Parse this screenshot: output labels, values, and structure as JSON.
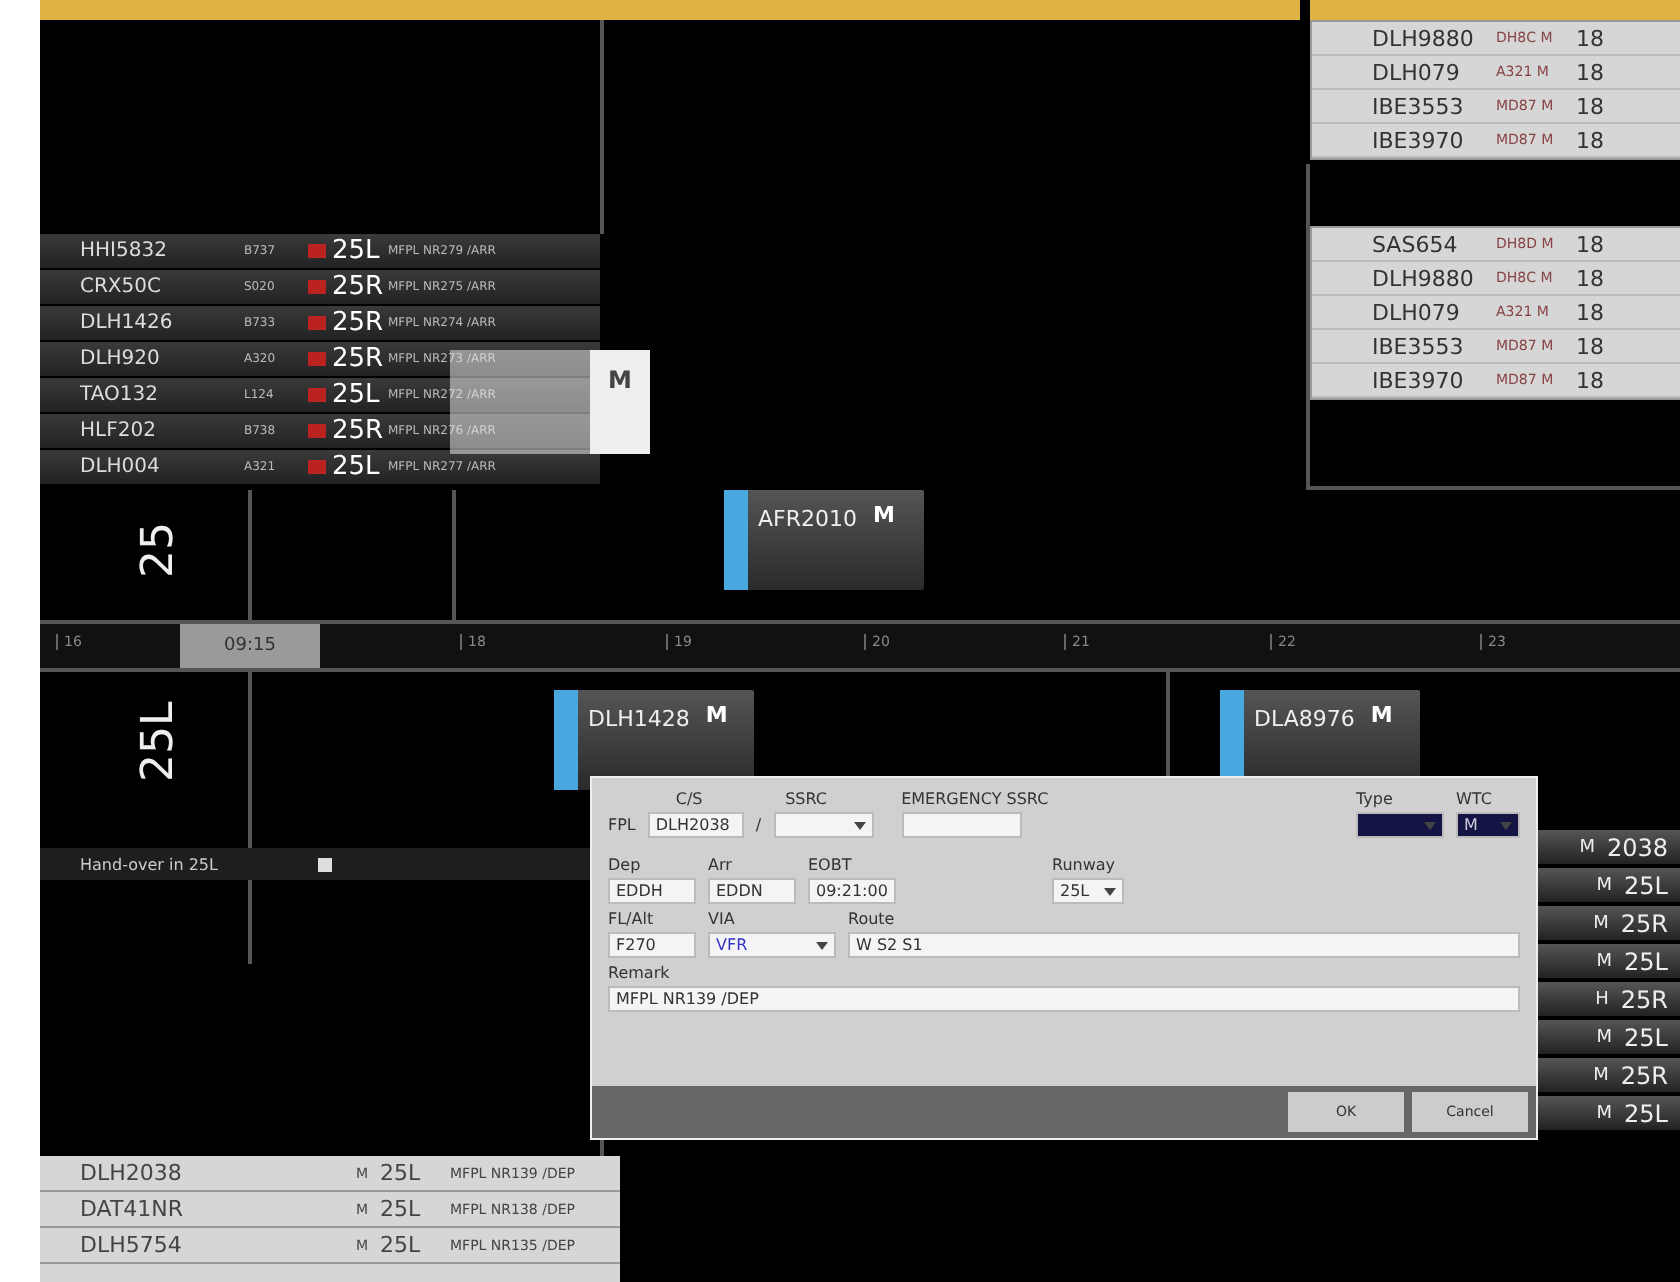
{
  "top_lists": [
    {
      "rows": [
        {
          "callsign": "DLH9880",
          "type": "DH8C",
          "wtc": "M",
          "value": "18"
        },
        {
          "callsign": "DLH079",
          "type": "A321",
          "wtc": "M",
          "value": "18"
        },
        {
          "callsign": "IBE3553",
          "type": "MD87",
          "wtc": "M",
          "value": "18"
        },
        {
          "callsign": "IBE3970",
          "type": "MD87",
          "wtc": "M",
          "value": "18"
        }
      ]
    },
    {
      "rows": [
        {
          "callsign": "SAS654",
          "type": "DH8D",
          "wtc": "M",
          "value": "18"
        },
        {
          "callsign": "DLH9880",
          "type": "DH8C",
          "wtc": "M",
          "value": "18"
        },
        {
          "callsign": "DLH079",
          "type": "A321",
          "wtc": "M",
          "value": "18"
        },
        {
          "callsign": "IBE3553",
          "type": "MD87",
          "wtc": "M",
          "value": "18"
        },
        {
          "callsign": "IBE3970",
          "type": "MD87",
          "wtc": "M",
          "value": "18"
        }
      ]
    }
  ],
  "arrival_list": {
    "rows": [
      {
        "callsign": "HHI5832",
        "type": "B737",
        "runway": "25L",
        "remark": "MFPL NR279 /ARR"
      },
      {
        "callsign": "CRX50C",
        "type": "S020",
        "runway": "25R",
        "remark": "MFPL NR275 /ARR"
      },
      {
        "callsign": "DLH1426",
        "type": "B733",
        "runway": "25R",
        "remark": "MFPL NR274 /ARR"
      },
      {
        "callsign": "DLH920",
        "type": "A320",
        "runway": "25R",
        "remark": "MFPL NR273 /ARR"
      },
      {
        "callsign": "TAO132",
        "type": "L124",
        "runway": "25L",
        "remark": "MFPL NR272 /ARR"
      },
      {
        "callsign": "HLF202",
        "type": "B738",
        "runway": "25R",
        "remark": "MFPL NR276 /ARR"
      },
      {
        "callsign": "DLH004",
        "type": "A321",
        "runway": "25L",
        "remark": "MFPL NR277 /ARR"
      }
    ]
  },
  "popup": {
    "wtc": "M"
  },
  "upper_lane": {
    "label": "25"
  },
  "lower_lane": {
    "label": "25L"
  },
  "strips": [
    {
      "callsign": "AFR2010",
      "wtc": "M"
    },
    {
      "callsign": "DLH1428",
      "wtc": "M"
    },
    {
      "callsign": "DLA8976",
      "wtc": "M"
    }
  ],
  "timeline": {
    "current": "09:15",
    "ticks": [
      "16",
      "18",
      "19",
      "20",
      "21",
      "22",
      "23"
    ]
  },
  "handover": {
    "label": "Hand-over in 25L",
    "checked": false
  },
  "dialog": {
    "cs_label": "C/S",
    "ssrc_label": "SSRC",
    "emergency_label": "EMERGENCY SSRC",
    "type_label": "Type",
    "wtc_label": "WTC",
    "fpl_label": "FPL",
    "callsign": "DLH2038",
    "separator": "/",
    "wtc": "M",
    "dep_label": "Dep",
    "dep": "EDDH",
    "arr_label": "Arr",
    "arr": "EDDN",
    "eobt_label": "EOBT",
    "eobt": "09:21:00",
    "runway_label": "Runway",
    "runway": "25L",
    "fl_label": "FL/Alt",
    "fl": "F270",
    "via_label": "VIA",
    "via": "VFR",
    "route_label": "Route",
    "route": "W S2 S1",
    "remark_label": "Remark",
    "remark": "MFPL NR139 /DEP",
    "buttons": [
      "OK",
      "Cancel"
    ]
  },
  "background_list": {
    "rows": [
      {
        "wtc": "M",
        "runway": "2038"
      },
      {
        "wtc": "M",
        "runway": "25L"
      },
      {
        "wtc": "M",
        "runway": "25R"
      },
      {
        "wtc": "M",
        "runway": "25L"
      },
      {
        "wtc": "H",
        "runway": "25R"
      },
      {
        "wtc": "M",
        "runway": "25L"
      },
      {
        "wtc": "M",
        "runway": "25R"
      },
      {
        "wtc": "M",
        "runway": "25L"
      }
    ]
  },
  "departure_list": {
    "rows": [
      {
        "callsign": "DLH2038",
        "wtc": "M",
        "runway": "25L",
        "remark": "MFPL NR139 /DEP"
      },
      {
        "callsign": "DAT41NR",
        "wtc": "M",
        "runway": "25L",
        "remark": "MFPL NR138 /DEP"
      },
      {
        "callsign": "DLH5754",
        "wtc": "M",
        "runway": "25L",
        "remark": "MFPL NR135 /DEP"
      }
    ]
  }
}
